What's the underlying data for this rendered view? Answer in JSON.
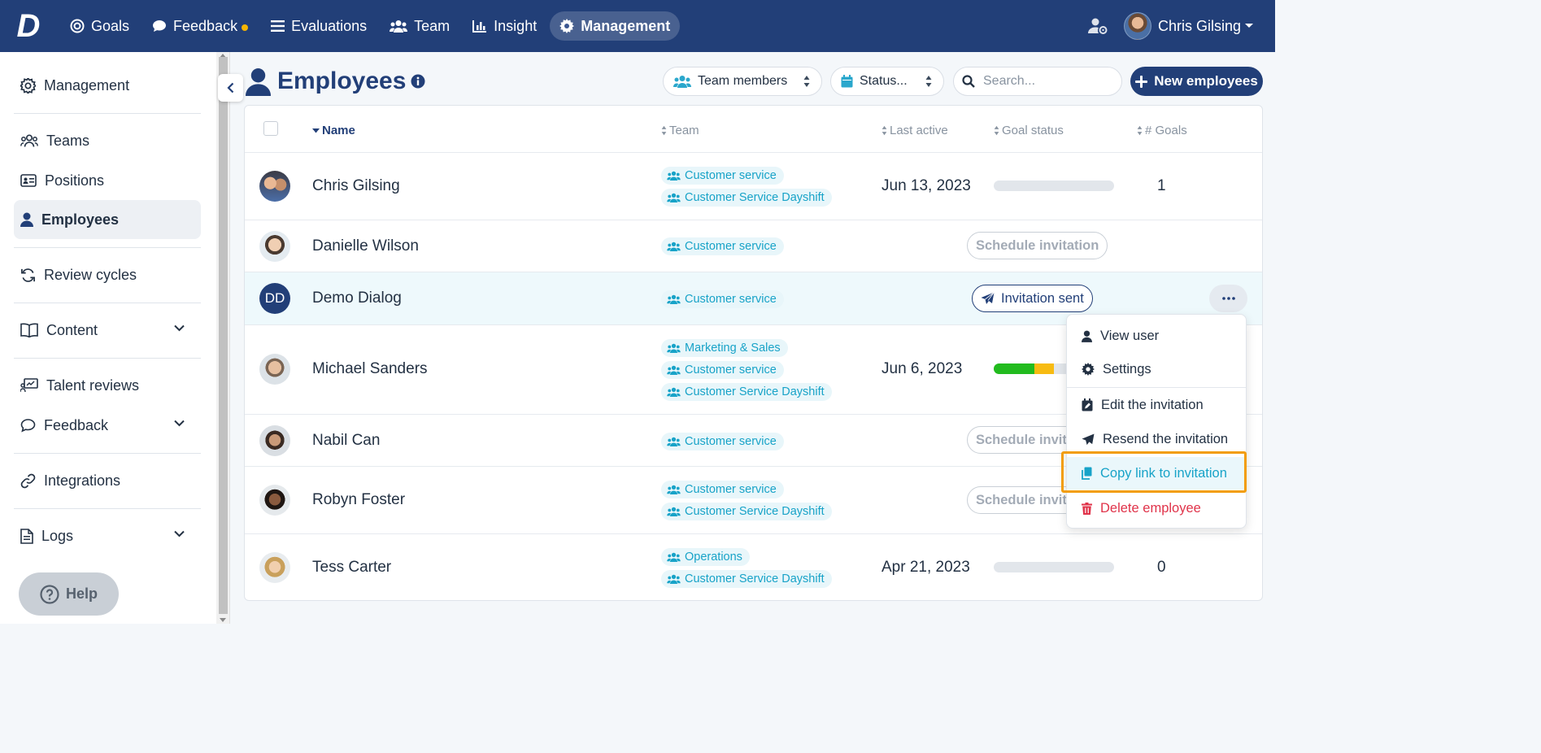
{
  "nav": {
    "items": [
      {
        "label": "Goals",
        "icon": "target-icon"
      },
      {
        "label": "Feedback",
        "icon": "chat-icon",
        "dot": true
      },
      {
        "label": "Evaluations",
        "icon": "list-icon"
      },
      {
        "label": "Team",
        "icon": "users-icon"
      },
      {
        "label": "Insight",
        "icon": "chart-icon"
      },
      {
        "label": "Management",
        "icon": "gear-icon",
        "active": true
      }
    ],
    "user_name": "Chris Gilsing",
    "accent_color": "#223f78"
  },
  "sidebar": {
    "items": [
      {
        "label": "Management"
      },
      {
        "label": "Teams"
      },
      {
        "label": "Positions"
      },
      {
        "label": "Employees",
        "active": true
      },
      {
        "label": "Review cycles"
      },
      {
        "label": "Content",
        "expandable": true
      },
      {
        "label": "Talent reviews"
      },
      {
        "label": "Feedback",
        "expandable": true
      },
      {
        "label": "Integrations"
      },
      {
        "label": "Logs",
        "expandable": true
      }
    ],
    "help_label": "Help"
  },
  "page": {
    "title": "Employees",
    "filter_team": "Team members",
    "filter_status": "Status...",
    "search_placeholder": "Search...",
    "new_button": "New employees"
  },
  "table": {
    "columns": [
      "Name",
      "Team",
      "Last active",
      "Goal status",
      "# Goals"
    ],
    "rows": [
      {
        "name": "Chris Gilsing",
        "teams": [
          "Customer service",
          "Customer Service Dayshift"
        ],
        "last_active": "Jun 13, 2023",
        "goal_progress": {
          "green": 0,
          "yellow": 0
        },
        "goals": "1"
      },
      {
        "name": "Danielle Wilson",
        "teams": [
          "Customer service"
        ],
        "action": "Schedule invitation"
      },
      {
        "name": "Demo Dialog",
        "initials": "DD",
        "teams": [
          "Customer service"
        ],
        "action": "Invitation sent",
        "highlighted": true
      },
      {
        "name": "Michael Sanders",
        "teams": [
          "Marketing & Sales",
          "Customer service",
          "Customer Service Dayshift"
        ],
        "last_active": "Jun 6, 2023",
        "goal_progress": {
          "green": 0.34,
          "yellow": 0.16
        }
      },
      {
        "name": "Nabil Can",
        "teams": [
          "Customer service"
        ],
        "action": "Schedule invitation"
      },
      {
        "name": "Robyn Foster",
        "teams": [
          "Customer service",
          "Customer Service Dayshift"
        ],
        "action": "Schedule invitation"
      },
      {
        "name": "Tess Carter",
        "teams": [
          "Operations",
          "Customer Service Dayshift"
        ],
        "last_active": "Apr 21, 2023",
        "goal_progress": {
          "green": 0,
          "yellow": 0
        },
        "goals": "0"
      }
    ]
  },
  "menu": {
    "items": [
      "View user",
      "Settings",
      "Edit the invitation",
      "Resend the invitation",
      "Copy link to invitation",
      "Delete employee"
    ],
    "focused": "Copy link to invitation"
  }
}
